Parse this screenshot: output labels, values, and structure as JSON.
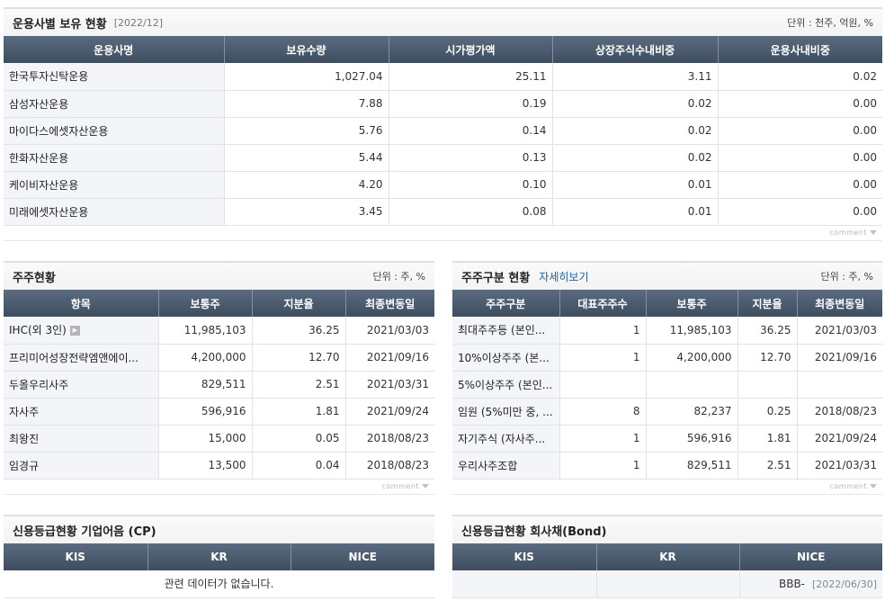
{
  "fund_holdings": {
    "title": "운용사별 보유 현황",
    "date": "[2022/12]",
    "unit": "단위 : 천주, 억원, %",
    "headers": [
      "운용사명",
      "보유수량",
      "시가평가액",
      "상장주식수내비중",
      "운용사내비중"
    ],
    "rows": [
      [
        "한국투자신탁운용",
        "1,027.04",
        "25.11",
        "3.11",
        "0.02"
      ],
      [
        "삼성자산운용",
        "7.88",
        "0.19",
        "0.02",
        "0.00"
      ],
      [
        "마이다스에셋자산운용",
        "5.76",
        "0.14",
        "0.02",
        "0.00"
      ],
      [
        "한화자산운용",
        "5.44",
        "0.13",
        "0.02",
        "0.00"
      ],
      [
        "케이비자산운용",
        "4.20",
        "0.10",
        "0.01",
        "0.00"
      ],
      [
        "미래에셋자산운용",
        "3.45",
        "0.08",
        "0.01",
        "0.00"
      ]
    ]
  },
  "shareholders": {
    "title": "주주현황",
    "unit": "단위 : 주, %",
    "headers": [
      "항목",
      "보통주",
      "지분율",
      "최종변동일"
    ],
    "rows": [
      [
        "IHC(외 3인)",
        "11,985,103",
        "36.25",
        "2021/03/03"
      ],
      [
        "프리미어성장전략엠앤에이...",
        "4,200,000",
        "12.70",
        "2021/09/16"
      ],
      [
        "두올우리사주",
        "829,511",
        "2.51",
        "2021/03/31"
      ],
      [
        "자사주",
        "596,916",
        "1.81",
        "2021/09/24"
      ],
      [
        "최왕진",
        "15,000",
        "0.05",
        "2018/08/23"
      ],
      [
        "임경규",
        "13,500",
        "0.04",
        "2018/08/23"
      ]
    ]
  },
  "shareholder_class": {
    "title": "주주구분 현황",
    "link": "자세히보기",
    "unit": "단위 : 주, %",
    "headers": [
      "주주구분",
      "대표주주수",
      "보통주",
      "지분율",
      "최종변동일"
    ],
    "rows": [
      [
        "최대주주등 (본인...",
        "1",
        "11,985,103",
        "36.25",
        "2021/03/03"
      ],
      [
        "10%이상주주 (본...",
        "1",
        "4,200,000",
        "12.70",
        "2021/09/16"
      ],
      [
        "5%이상주주 (본인...",
        "",
        "",
        "",
        ""
      ],
      [
        "임원 (5%미만 중, ...",
        "8",
        "82,237",
        "0.25",
        "2018/08/23"
      ],
      [
        "자기주식 (자사주...",
        "1",
        "596,916",
        "1.81",
        "2021/09/24"
      ],
      [
        "우리사주조합",
        "1",
        "829,511",
        "2.51",
        "2021/03/31"
      ]
    ]
  },
  "credit_cp": {
    "title": "신용등급현황 기업어음 (CP)",
    "headers": [
      "KIS",
      "KR",
      "NICE"
    ],
    "empty_message": "관련 데이터가 없습니다."
  },
  "credit_bond": {
    "title": "신용등급현황 회사채(Bond)",
    "headers": [
      "KIS",
      "KR",
      "NICE"
    ],
    "nice_rating": "BBB-",
    "nice_date": "[2022/06/30]"
  },
  "comment_label": "comment"
}
